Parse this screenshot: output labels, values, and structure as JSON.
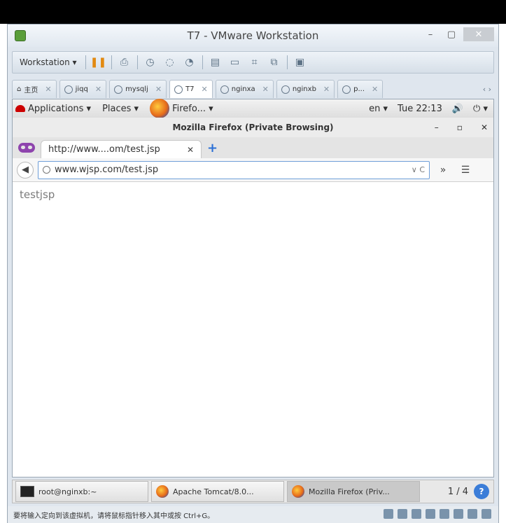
{
  "vmware": {
    "title": "T7 - VMware Workstation",
    "window_controls": {
      "minimize": "–",
      "maximize": "▢",
      "close": "✕"
    },
    "toolbar": {
      "workstation_menu": "Workstation ▾",
      "icons": [
        "pause-icon",
        "print-icon",
        "snapshot-icon",
        "snapshot-restore-icon",
        "snapshot-manager-icon",
        "view-sidebar-icon",
        "view-console-icon",
        "fullscreen-icon",
        "unity-icon",
        "library-icon"
      ]
    },
    "tabs": [
      {
        "label": "主页"
      },
      {
        "label": "jiqq"
      },
      {
        "label": "mysqlj"
      },
      {
        "label": "T7",
        "active": true
      },
      {
        "label": "nginxa"
      },
      {
        "label": "nginxb"
      },
      {
        "label": "p..."
      }
    ],
    "tab_scroll": "‹ ›",
    "status_text": "要将输入定向到该虚拟机，请将鼠标指针移入其中或按 Ctrl+G。"
  },
  "gnome": {
    "applications": "Applications ▾",
    "places": "Places ▾",
    "firefox_launcher": "Firefo... ▾",
    "input_lang": "en ▾",
    "clock": "Tue 22:13",
    "volume": "🔊",
    "power": "⏻ ▾"
  },
  "firefox": {
    "window_title": "Mozilla Firefox (Private Browsing)",
    "controls": {
      "minimize": "–",
      "maximize": "▫",
      "close": "✕"
    },
    "tab_label": "http://www....om/test.jsp",
    "tab_close": "✕",
    "new_tab": "+",
    "url": "www.wjsp.com/test.jsp",
    "url_right": "∨ C",
    "overflow": "»",
    "menu": "☰",
    "page_text": "testjsp"
  },
  "taskbar": {
    "items": [
      {
        "label": "root@nginxb:~"
      },
      {
        "label": "Apache Tomcat/8.0..."
      },
      {
        "label": "Mozilla Firefox (Priv...",
        "active": true
      }
    ],
    "pager": "1 / 4"
  }
}
